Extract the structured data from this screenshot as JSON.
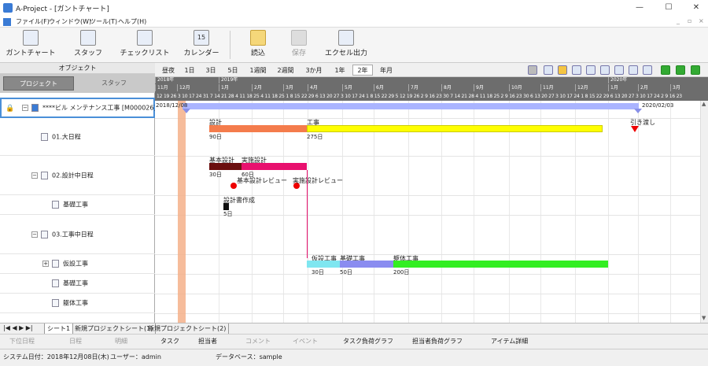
{
  "window": {
    "title": "A-Project - [ガントチャート]",
    "minimize": "—",
    "maximize": "☐",
    "close": "✕"
  },
  "menu": [
    "ファイル(F)",
    "ウィンドウ(W)",
    "ツール(T)",
    "ヘルプ(H)"
  ],
  "toolbar": {
    "buttons": [
      "ガントチャート",
      "スタッフ",
      "チェックリスト",
      "カレンダー",
      "読込",
      "保存",
      "エクセル出力"
    ],
    "calendar_icon_number": "15"
  },
  "object_panel": {
    "header": "オブジェクト",
    "tabs": [
      "プロジェクト",
      "スタッフ"
    ],
    "tree": [
      {
        "label": "****ビル メンテナンス工事 [M000026]"
      },
      {
        "label": "01.大日程"
      },
      {
        "label": "02.設計中日程"
      },
      {
        "label": "基礎工事"
      },
      {
        "label": "03.工事中日程"
      },
      {
        "label": "仮設工事"
      },
      {
        "label": "基礎工事"
      },
      {
        "label": "躯体工事"
      }
    ]
  },
  "scale_buttons": [
    "昼夜",
    "1日",
    "3日",
    "5日",
    "1週間",
    "2週間",
    "3か月",
    "1年",
    "2年",
    "年月"
  ],
  "active_scale": "2年",
  "date_header": {
    "years": [
      "2018年",
      "2019年",
      "2020年"
    ],
    "months": [
      "11月",
      "12月",
      "1月",
      "2月",
      "3月",
      "4月",
      "5月",
      "6月",
      "7月",
      "8月",
      "9月",
      "10月",
      "11月",
      "12月",
      "1月",
      "2月",
      "3月"
    ],
    "days_text": "12 19 26 3 10 17 24 31 7 14 21 28 4 11 18 25 4 11 18 25 1 8 15 22 29 6 13 20 27 3 10 17 24 1 8 15 22 29 5 12 19 26 2 9 16 23 30 7 14 21 28 4 11 18 25 2 9 16 23 30 6 13 20 27 3 10 17 24 1 8 15 22 29 6 13 20 27 3 10 17 24 2 9 16 23"
  },
  "chart": {
    "project_start": "2018/12/08",
    "project_end": "2020/02/03",
    "milestone_final": "引き渡し",
    "bars": {
      "sekkei": {
        "label": "設計",
        "dur": "90日"
      },
      "kouji": {
        "label": "工事",
        "dur": "275日"
      },
      "kihon_sekkei": {
        "label": "基本設計",
        "dur": "30日"
      },
      "jisshi_sekkei": {
        "label": "実施設計",
        "dur": "60日"
      },
      "kihon_review": {
        "label": "基本設計レビュー"
      },
      "jisshi_review": {
        "label": "実施設計レビュー"
      },
      "sekkeisho": {
        "label": "設計書作成",
        "dur": "5日"
      },
      "kasetsu": {
        "label": "仮設工事",
        "dur": "30日"
      },
      "kiso": {
        "label": "基礎工事",
        "dur": "50日"
      },
      "kutai": {
        "label": "躯体工事",
        "dur": "200日"
      }
    },
    "colors": {
      "summary": "#aab4ff",
      "sekkei": "#f47c4c",
      "kouji": "#ffff00",
      "kihon": "#6b0f0f",
      "jisshi": "#e8106e",
      "kasetsu": "#7fe6f0",
      "kiso": "#8a8cf0",
      "kutai": "#33ee22",
      "today": "#f4b08a"
    }
  },
  "sheets": [
    "シート1",
    "新規プロジェクトシート(1)",
    "新規プロジェクトシート(2)"
  ],
  "bottom_tools": [
    "下位日程",
    "日程",
    "明細",
    "タスク",
    "担当者",
    "コメント",
    "イベント",
    "タスク負荷グラフ",
    "担当者負荷グラフ",
    "アイテム詳細"
  ],
  "status": {
    "date": "システム日付：2018年12月08日(木)",
    "user": "ユーザー：admin",
    "db": "データベース：sample"
  }
}
